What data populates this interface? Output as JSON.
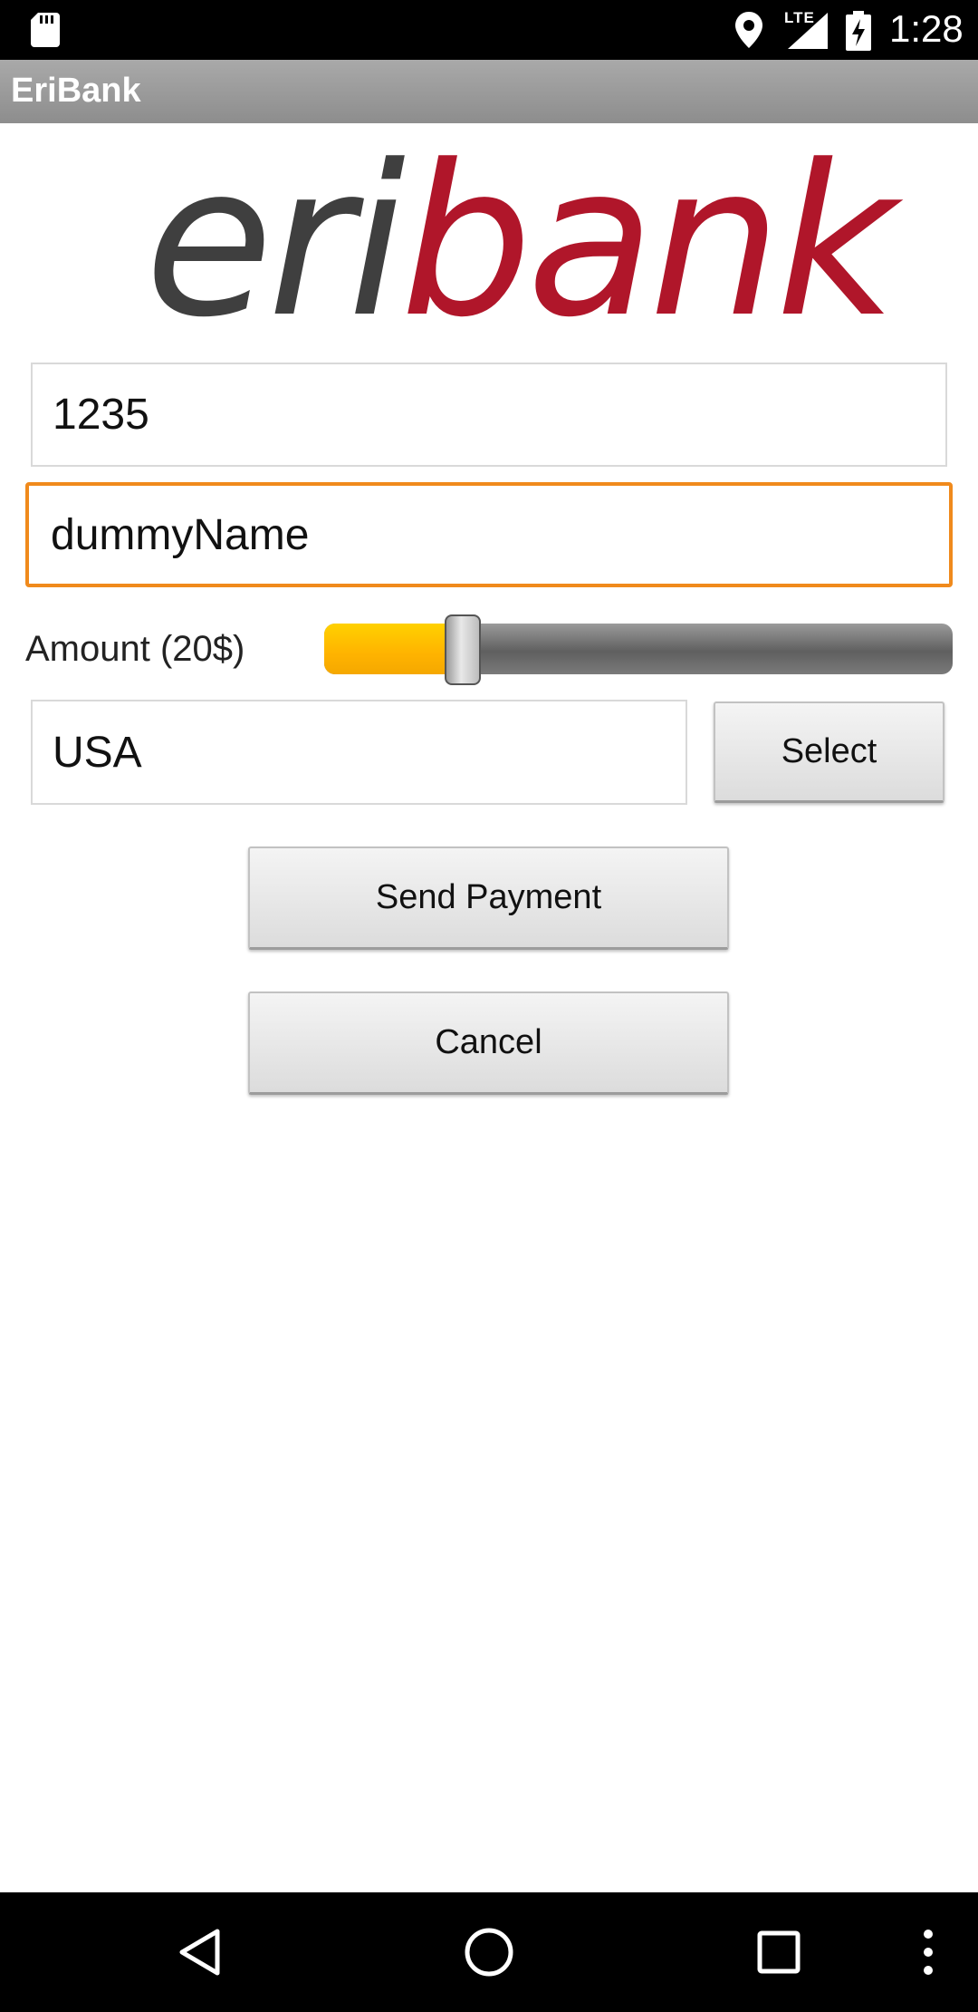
{
  "status_bar": {
    "time": "1:28",
    "network": "LTE",
    "icons": [
      "sd-card-icon",
      "location-icon",
      "signal-icon",
      "battery-charging-icon"
    ]
  },
  "app": {
    "title": "EriBank",
    "logo_text_1": "eri",
    "logo_text_2": "bank",
    "logo_colors": {
      "dark": "#3f3f3f",
      "red": "#b0162a"
    }
  },
  "form": {
    "account": {
      "value": "1235"
    },
    "name": {
      "value": "dummyName"
    },
    "amount": {
      "label": "Amount (20$)",
      "slider_fraction": 0.22
    },
    "country": {
      "value": "USA"
    },
    "select_label": "Select",
    "send_label": "Send Payment",
    "cancel_label": "Cancel"
  },
  "colors": {
    "focus_border": "#f08a1c",
    "slider_fill": "#ffc400",
    "action_bar": "#9b9b9b"
  },
  "nav_bar": {
    "icons": [
      "back-icon",
      "home-icon",
      "recents-icon",
      "overflow-menu-icon"
    ]
  }
}
